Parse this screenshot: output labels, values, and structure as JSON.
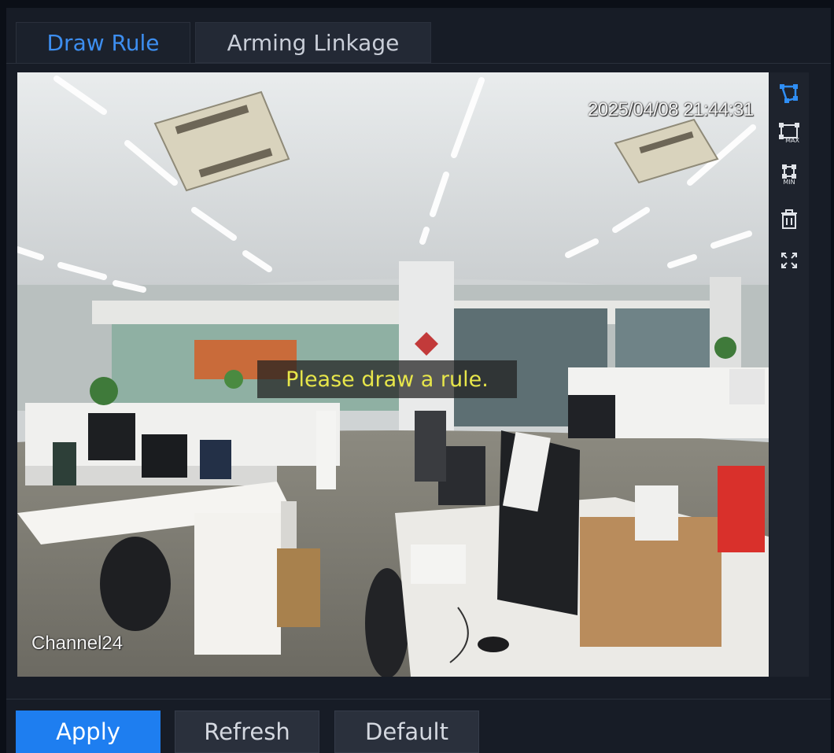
{
  "tabs": [
    {
      "label": "Draw Rule",
      "active": true
    },
    {
      "label": "Arming Linkage",
      "active": false
    }
  ],
  "video": {
    "timestamp": "2025/04/08 21:44:31",
    "channel": "Channel24",
    "hint": "Please draw a rule."
  },
  "toolbar": {
    "draw": {
      "icon": "draw-rule-icon"
    },
    "max": {
      "icon": "max-size-icon",
      "caption": "MAX"
    },
    "min": {
      "icon": "min-size-icon",
      "caption": "MIN"
    },
    "delete": {
      "icon": "trash-icon"
    },
    "fullscreen": {
      "icon": "fullscreen-icon"
    }
  },
  "buttons": {
    "apply": "Apply",
    "refresh": "Refresh",
    "default": "Default"
  },
  "colors": {
    "accent": "#1e7ef0",
    "active_tab_text": "#3d8ef0",
    "hint_text": "#e7e64a",
    "panel_bg": "#171c26"
  }
}
